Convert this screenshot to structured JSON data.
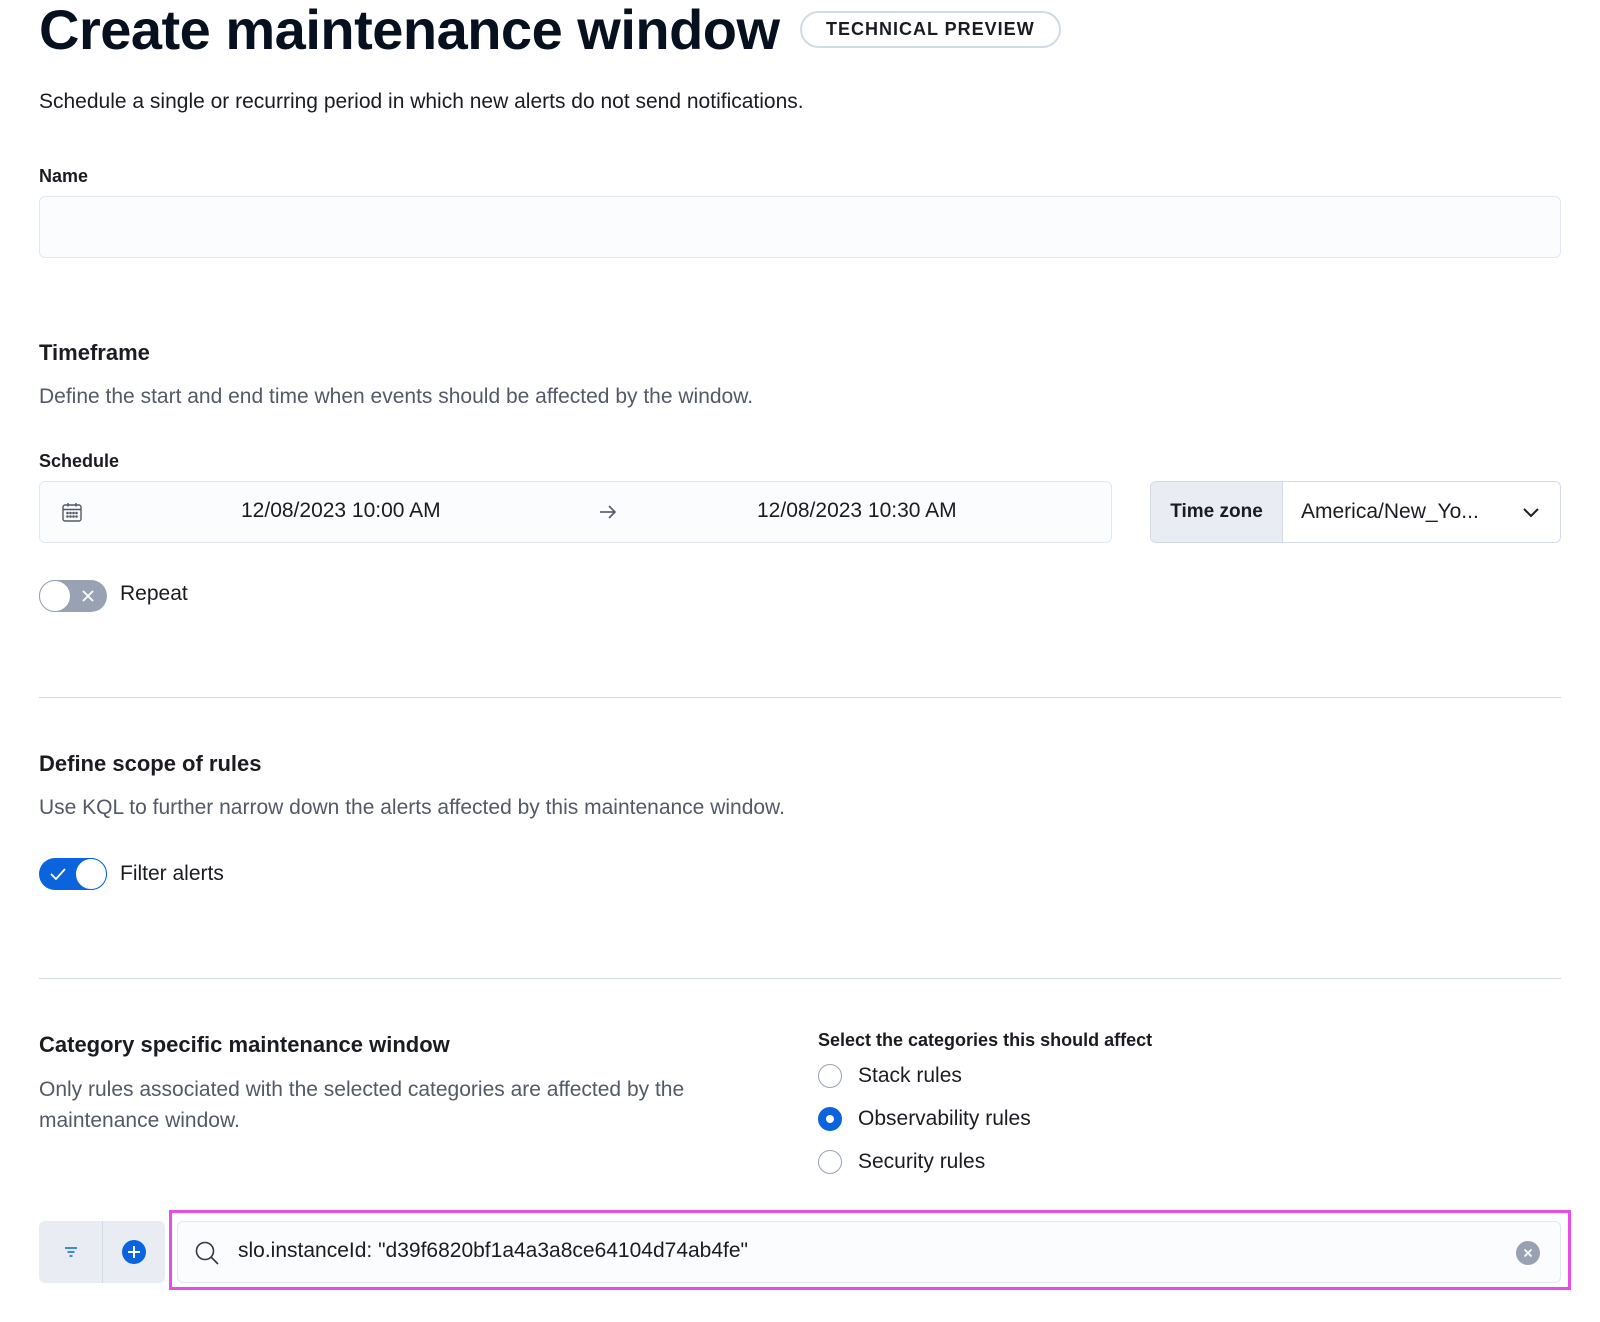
{
  "header": {
    "title": "Create maintenance window",
    "badge": "TECHNICAL PREVIEW",
    "description": "Schedule a single or recurring period in which new alerts do not send notifications."
  },
  "name_field": {
    "label": "Name",
    "value": "",
    "placeholder": ""
  },
  "timeframe": {
    "title": "Timeframe",
    "description": "Define the start and end time when events should be affected by the window.",
    "schedule_label": "Schedule",
    "start": "12/08/2023 10:00 AM",
    "end": "12/08/2023 10:30 AM",
    "timezone_label": "Time zone",
    "timezone_value": "America/New_Yo...",
    "repeat_label": "Repeat",
    "repeat_enabled": false
  },
  "scope": {
    "title": "Define scope of rules",
    "description": "Use KQL to further narrow down the alerts affected by this maintenance window.",
    "filter_label": "Filter alerts",
    "filter_enabled": true
  },
  "category": {
    "title": "Category specific maintenance window",
    "description": "Only rules associated with the selected categories are affected by the maintenance window.",
    "select_label": "Select the categories this should affect",
    "options": [
      {
        "label": "Stack rules",
        "checked": false
      },
      {
        "label": "Observability rules",
        "checked": true
      },
      {
        "label": "Security rules",
        "checked": false
      }
    ]
  },
  "query_bar": {
    "query": "slo.instanceId: \"d39f6820bf1a4a3a8ce64104d74ab4fe\"",
    "filter_icon": "filter-icon",
    "add_icon": "plus-circle-icon",
    "search_icon": "search-icon",
    "clear_icon": "clear-icon"
  },
  "colors": {
    "primary": "#0b64dd",
    "highlight": "#e64ce6",
    "toggle_off": "#98a2b3"
  }
}
